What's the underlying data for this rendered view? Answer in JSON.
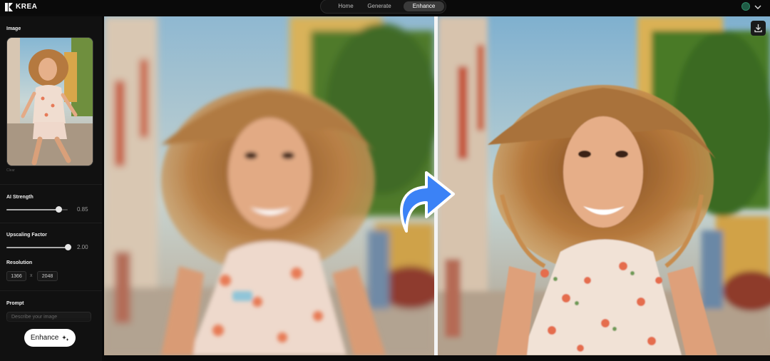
{
  "app": {
    "name": "KREA"
  },
  "nav": {
    "tabs": [
      {
        "label": "Home"
      },
      {
        "label": "Generate"
      },
      {
        "label": "Enhance"
      }
    ],
    "active": "Enhance"
  },
  "header": {
    "avatar_icon": "user-avatar-icon",
    "menu_icon": "chevron-down-icon"
  },
  "sidebar": {
    "image_label": "Image",
    "clear_label": "Clear",
    "ai_strength": {
      "label": "AI Strength",
      "value": "0.85",
      "level": 0.85
    },
    "upscaling": {
      "label": "Upscaling Factor",
      "value": "2.00",
      "level": 1.0
    },
    "resolution": {
      "label": "Resolution",
      "width": "1366",
      "separator": "x",
      "height": "2048"
    },
    "prompt": {
      "label": "Prompt",
      "placeholder": "Describe your image"
    },
    "enhance_button": "Enhance"
  },
  "preview": {
    "download_icon": "download-icon",
    "compare_icon": "curved-arrow-icon"
  },
  "colors": {
    "accent_arrow": "#3b82f6",
    "active_tab": "#3a3a3a"
  }
}
